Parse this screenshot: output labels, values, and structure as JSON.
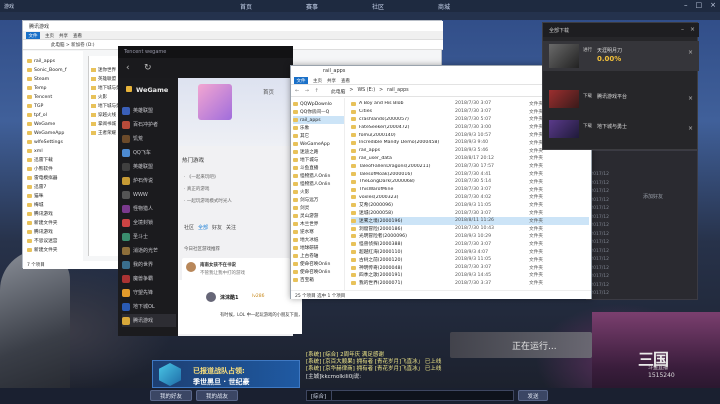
{
  "game": {
    "tab_title": "游戏",
    "nav": [
      "首页",
      "赛事",
      "社区",
      "商城"
    ],
    "running_label": "正在运行...",
    "live_logo": "三国",
    "live_name": "斗鱼直播",
    "live_num": "1515240",
    "promo_line1": "已报道战队占领:",
    "promo_line2": "季世黑旦 · 世纪豪",
    "bar_buttons": [
      "我的好友",
      "我的战友",
      "发送"
    ],
    "chat_channel": "[综合]",
    "chat_lines": [
      "[系统] [综合] 2周年庆 满足感谢",
      "[系统] [京百大顺果] 拥有者 [青花岁月]飞直冰」 已上线",
      "[系统] [京华赫律商] 拥有者 [青花岁月]飞直冰」 已上线",
      "[主城]kkcmolkili0j说:"
    ],
    "right_panel_hint": "添加好友",
    "right_panel_col": [
      "2017/12",
      "2017/12",
      "2017/12",
      "2017/12",
      "2017/12",
      "2017/12",
      "2017/12",
      "2017/12",
      "2017/12",
      "2017/12",
      "2017/12",
      "2017/12",
      "2017/12",
      "2017/12",
      "2017/12"
    ]
  },
  "explorer_back": {
    "title": "腾讯游戏",
    "ribbon_file": "文件",
    "ribbon_tabs": [
      "主页",
      "共享",
      "查看"
    ],
    "address": "此电脑 > 新加卷 (D:)",
    "tree": [
      "rail_apps",
      "Sonic_Boom_f",
      "Steam",
      "Temp",
      "Tencent",
      "TGP",
      "tpf_ol",
      "WeGame",
      "WeGameApp",
      "wlfeSettings",
      "xml",
      "迅雷下载",
      "小熊软件",
      "雷电模拟器",
      "迅雷7",
      "猫咪",
      "梅城",
      "腾讯游戏",
      "新建文件夹",
      "腾讯游戏",
      "不思议迷宫",
      "新建文件夹"
    ],
    "status": "7 个项目"
  },
  "explorer_mid": {
    "rows": [
      "迷你世界",
      "英雄联盟",
      "地下城与勇士",
      "火影",
      "地下城与勇士",
      "穿越火线",
      "掌阅书城",
      "王者荣耀"
    ]
  },
  "qq": {
    "title": "Tencent wegame",
    "brand": "WeGame",
    "sidebar": [
      "英雄联盟",
      "百石冲护者",
      "饥荒",
      "QQ飞车",
      "英雄联盟",
      "炉石传说",
      "WWW",
      "怪物猎人",
      "全境封锁",
      "圣斗士",
      "消逝的光芒",
      "我的世界",
      "魔兽争霸",
      "守望先锋",
      "地下城OL",
      "腾讯游戏",
      "QQ堂",
      "怪物时代"
    ],
    "home": "首页",
    "hot": "热门游戏",
    "items": [
      "· 《一起来玩吧》",
      "· 真正的游戏",
      "· 一起玩游戏模式时光人"
    ],
    "seg": [
      "社区",
      "全部",
      "好友",
      "关注"
    ],
    "today": "今日社区游戏推荐",
    "post1_name": "南南女孩不在书说",
    "post1_text": "不管我让我中打的游戏",
    "post1_reply": "不管现在的游戏，我们来",
    "post2_name": "沫沫酷1",
    "post2_tag": "lv286",
    "post2_text": "有时候，LOL 中一起玩游戏的小朋友下面，我看个我会小确幸"
  },
  "explorer": {
    "title": "rail_apps",
    "ribbon_file": "文件",
    "ribbon_tabs": [
      "主页",
      "共享",
      "查看"
    ],
    "nav": "← → ↑",
    "path": [
      "此电脑",
      ">",
      "WS (E:)",
      ">",
      "rail_apps"
    ],
    "tree": [
      {
        "label": "QQWpDownlo"
      },
      {
        "label": "QQ你房间—Q"
      },
      {
        "label": "rail_apps",
        "selected": true
      },
      {
        "label": "乐象"
      },
      {
        "label": "其它"
      },
      {
        "label": "WeGameApp"
      },
      {
        "label": "迷途之路"
      },
      {
        "label": "地下城与"
      },
      {
        "label": "斗鱼直播"
      },
      {
        "label": "怪物猎人Onlin"
      },
      {
        "label": "怪物猎人Onlin"
      },
      {
        "label": "火影"
      },
      {
        "label": "剑与远万"
      },
      {
        "label": "剑灵"
      },
      {
        "label": "灵山游游"
      },
      {
        "label": "木兰世界"
      },
      {
        "label": "逆水寒"
      },
      {
        "label": "地大冰纸"
      },
      {
        "label": "地球研研"
      },
      {
        "label": "上古卷轴"
      },
      {
        "label": "使命召唤Onlin"
      },
      {
        "label": "使命召唤Onlin"
      },
      {
        "label": "百宝箱"
      }
    ],
    "rows": [
      {
        "name": "A Boy and His Blob",
        "date": "2018/7/30 3:07",
        "type": "文件夹"
      },
      {
        "name": "Cities",
        "date": "2018/7/30 3:07",
        "type": "文件夹"
      },
      {
        "name": "crashlands(2000057)",
        "date": "2018/7/30 5:07",
        "type": "文件夹"
      },
      {
        "name": "FateSeeker(2000472)",
        "date": "2018/7/30 3:00",
        "type": "文件夹"
      },
      {
        "name": "fomu(2000140)",
        "date": "2018/9/3 10:57",
        "type": "文件夹"
      },
      {
        "name": "Incredible Mandy Demo(2000458)",
        "date": "2018/9/3 9:40",
        "type": "文件夹"
      },
      {
        "name": "rail_apps",
        "date": "2018/9/3 5:46",
        "type": "文件夹"
      },
      {
        "name": "rail_user_data",
        "date": "2018/8/17 20:12",
        "type": "文件夹"
      },
      {
        "name": "TaleofFallenDragons(2000211)",
        "date": "2018/7/30 17:57",
        "type": "文件夹"
      },
      {
        "name": "TalesofMoak(2000016)",
        "date": "2018/7/30 4:41",
        "type": "文件夹"
      },
      {
        "name": "TheLongDark(2000068)",
        "date": "2018/7/30 5:14",
        "type": "文件夹"
      },
      {
        "name": "ThisWarofMine",
        "date": "2018/7/30 3:07",
        "type": "文件夹"
      },
      {
        "name": "voxles(2000323)",
        "date": "2018/7/30 4:02",
        "type": "文件夹"
      },
      {
        "name": "艾希(2000096)",
        "date": "2018/9/3 11:05",
        "type": "文件夹"
      },
      {
        "name": "迷城(2000058)",
        "date": "2018/7/30 3:07",
        "type": "文件夹"
      },
      {
        "name": "迷雾之境(2000196)",
        "date": "2018/8/11 11:26",
        "type": "文件夹",
        "selected": true
      },
      {
        "name": "洞窟冒险(2000186)",
        "date": "2018/7/30 10:43",
        "type": "文件夹"
      },
      {
        "name": "光明冒险者(2000096)",
        "date": "2018/9/3 10:29",
        "type": "文件夹"
      },
      {
        "name": "怪兽侦探(2000388)",
        "date": "2018/7/30 3:07",
        "type": "文件夹"
      },
      {
        "name": "超越红海(2000110)",
        "date": "2018/9/3 4:07",
        "type": "文件夹"
      },
      {
        "name": "古树之前(2000120)",
        "date": "2018/9/3 11:05",
        "type": "文件夹"
      },
      {
        "name": "神明传奇(2000048)",
        "date": "2018/7/30 3:07",
        "type": "文件夹"
      },
      {
        "name": "四季之歌(2000191)",
        "date": "2018/9/3 14:45",
        "type": "文件夹"
      },
      {
        "name": "我的世界(2000071)",
        "date": "2018/7/30 3:37",
        "type": "文件夹"
      },
      {
        "name": "百万吾帝(2000060)",
        "date": "2018/9/3 10:29",
        "type": "文件夹"
      }
    ],
    "status": "25 个项目   选中 1 个项目"
  },
  "download": {
    "title": "全部下载",
    "tag": "进行",
    "items": [
      {
        "name": "天涯明月刀",
        "pct": "0.00%",
        "progress": 0
      },
      {
        "name": "腾讯游戏平台",
        "tag": "下载"
      },
      {
        "name": "地下城与勇士",
        "tag": "下载"
      }
    ]
  }
}
